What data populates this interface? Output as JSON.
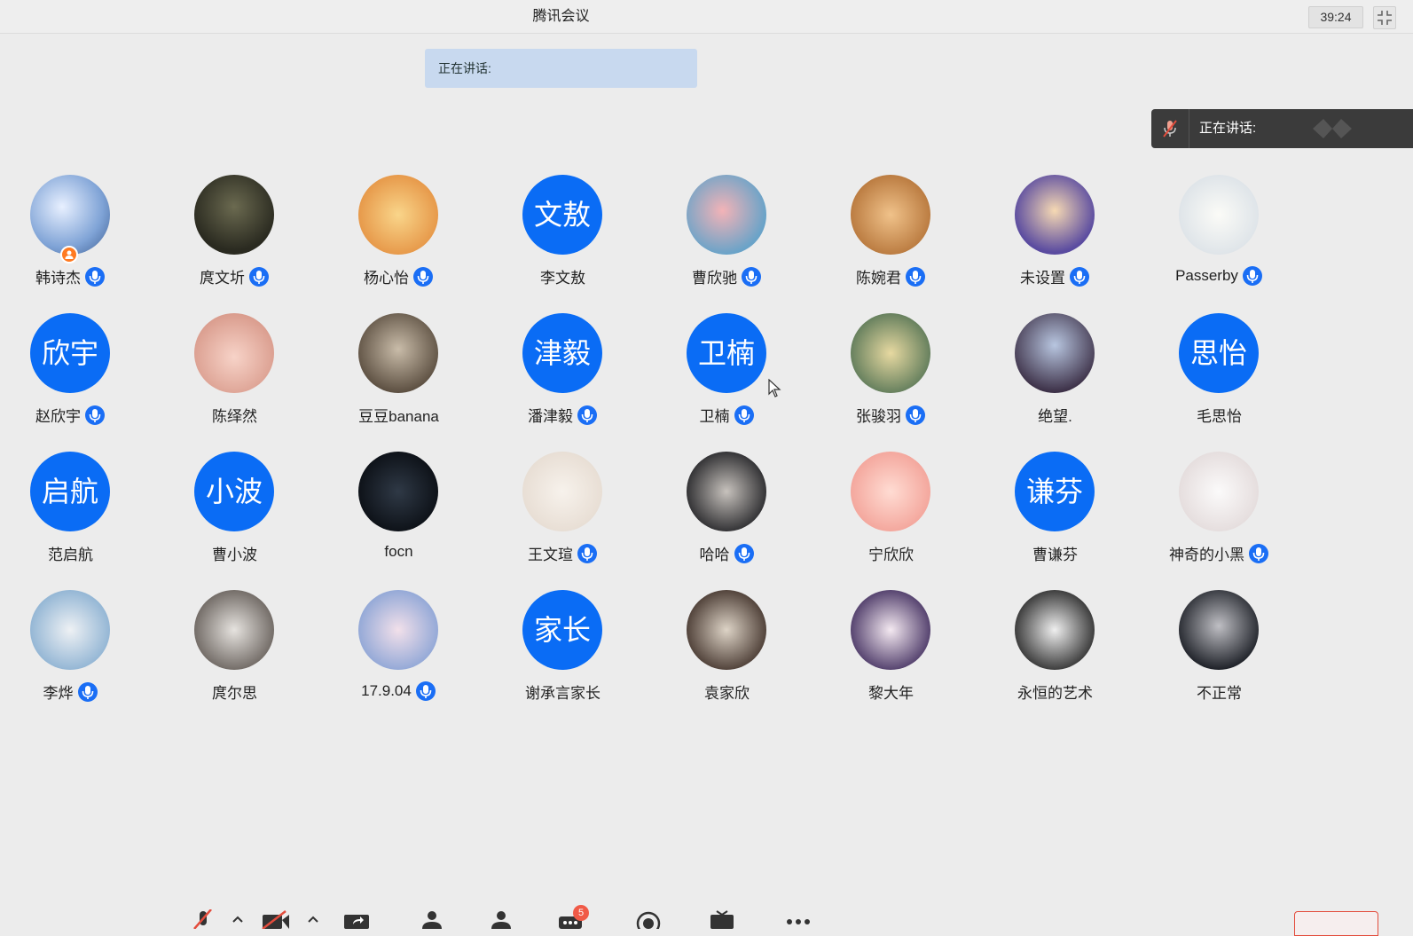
{
  "window": {
    "title": "腾讯会议",
    "timer": "39:24"
  },
  "speaking_banner": {
    "label": "正在讲话:"
  },
  "speaking_panel": {
    "label": "正在讲话:"
  },
  "colors": {
    "accent": "#0a6cf5",
    "host_badge": "#ff7a21",
    "chat_badge": "#f05a47",
    "end_button": "#e34c3c"
  },
  "participants": [
    {
      "name": "韩诗杰",
      "avatar": "photo-sky",
      "mic": true,
      "host": true
    },
    {
      "name": "庹文圻",
      "avatar": "photo-dark",
      "mic": true
    },
    {
      "name": "杨心怡",
      "avatar": "photo-cartoon",
      "mic": true
    },
    {
      "name": "李文敖",
      "avatar_text": "文敖",
      "mic": false
    },
    {
      "name": "曹欣驰",
      "avatar": "photo-pink",
      "mic": true
    },
    {
      "name": "陈婉君",
      "avatar": "photo-cat",
      "mic": true
    },
    {
      "name": "未设置",
      "avatar": "photo-anime-boy",
      "mic": true
    },
    {
      "name": "Passerby",
      "avatar": "photo-sketch",
      "mic": true
    },
    {
      "name": "赵欣宇",
      "avatar_text": "欣宇",
      "mic": true
    },
    {
      "name": "陈绎然",
      "avatar": "photo-illustration",
      "mic": false
    },
    {
      "name": "豆豆banana",
      "avatar": "photo-girl",
      "mic": false
    },
    {
      "name": "潘津毅",
      "avatar_text": "津毅",
      "mic": true
    },
    {
      "name": "卫楠",
      "avatar_text": "卫楠",
      "mic": true
    },
    {
      "name": "张骏羽",
      "avatar": "photo-car",
      "mic": true
    },
    {
      "name": "绝望.",
      "avatar": "photo-anime-face",
      "mic": false
    },
    {
      "name": "毛思怡",
      "avatar_text": "思怡",
      "mic": false
    },
    {
      "name": "范启航",
      "avatar_text": "启航",
      "mic": false
    },
    {
      "name": "曹小波",
      "avatar_text": "小波",
      "mic": false
    },
    {
      "name": "focn",
      "avatar": "photo-night",
      "mic": false
    },
    {
      "name": "王文瑄",
      "avatar": "photo-alpaca",
      "mic": true
    },
    {
      "name": "哈哈",
      "avatar": "photo-mask",
      "mic": true
    },
    {
      "name": "宁欣欣",
      "avatar": "photo-pink-blob",
      "mic": false
    },
    {
      "name": "曹谦芬",
      "avatar_text": "谦芬",
      "mic": false
    },
    {
      "name": "神奇的小黑",
      "avatar": "photo-sketch-girl",
      "mic": true
    },
    {
      "name": "李烨",
      "avatar": "photo-chibi-boy",
      "mic": true
    },
    {
      "name": "庹尔思",
      "avatar": "photo-portrait",
      "mic": false
    },
    {
      "name": "17.9.04",
      "avatar": "photo-shinchan",
      "mic": true
    },
    {
      "name": "谢承言家长",
      "avatar_text": "家长",
      "mic": false
    },
    {
      "name": "袁家欣",
      "avatar": "photo-bear",
      "mic": false
    },
    {
      "name": "黎大年",
      "avatar": "photo-anime-laugh",
      "mic": false
    },
    {
      "name": "永恒的艺术",
      "avatar": "photo-ink-warrior",
      "mic": false
    },
    {
      "name": "不正常",
      "avatar": "photo-basketball",
      "mic": false
    }
  ],
  "toolbar": {
    "chat_unread": "5"
  }
}
